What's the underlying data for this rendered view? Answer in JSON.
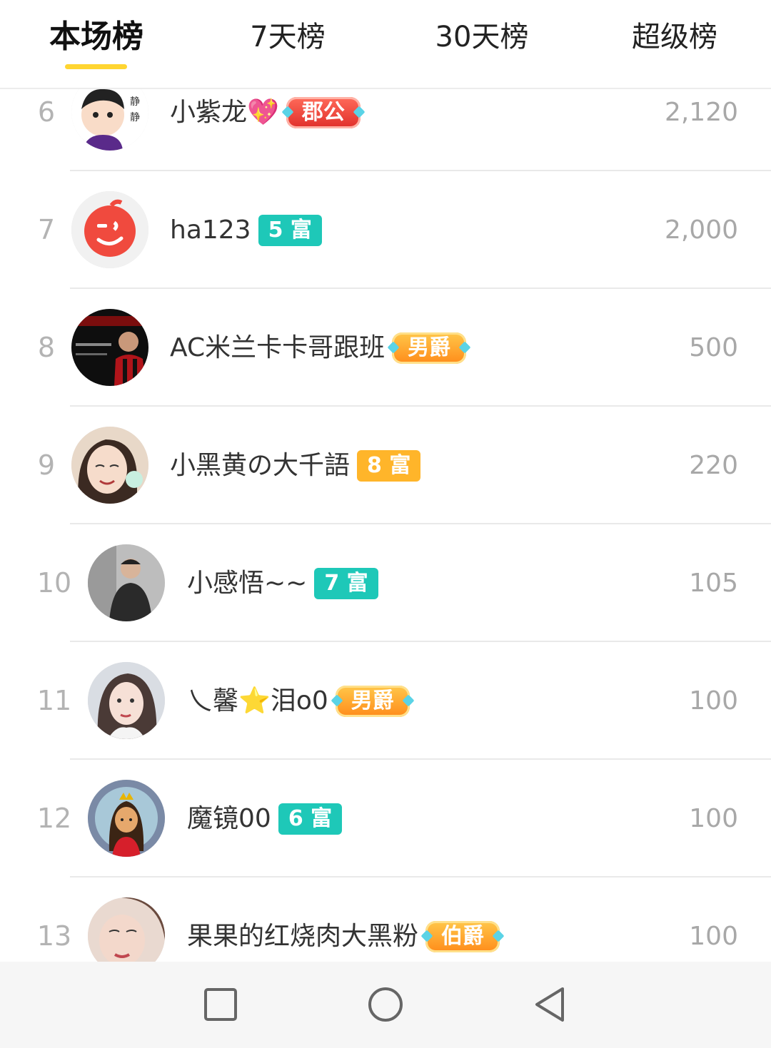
{
  "tabs": [
    {
      "label": "本场榜",
      "active": true
    },
    {
      "label": "7天榜",
      "active": false
    },
    {
      "label": "30天榜",
      "active": false
    },
    {
      "label": "超级榜",
      "active": false
    }
  ],
  "accent_color": "#ffd531",
  "rows": [
    {
      "rank": "6",
      "name": "小紫龙💖",
      "badge": "郡公",
      "badge_style": "noble-red",
      "score": "2,120"
    },
    {
      "rank": "7",
      "name": "ha123",
      "badge": "5 富",
      "badge_style": "teal",
      "score": "2,000"
    },
    {
      "rank": "8",
      "name": "AC米兰卡卡哥跟班",
      "badge": "男爵",
      "badge_style": "noble",
      "score": "500"
    },
    {
      "rank": "9",
      "name": "小黑黄の大千語",
      "badge": "8 富",
      "badge_style": "orange",
      "score": "220"
    },
    {
      "rank": "10",
      "name": "小感悟~~",
      "badge": "7 富",
      "badge_style": "teal",
      "score": "105"
    },
    {
      "rank": "11",
      "name": "乀馨⭐泪o0",
      "badge": "男爵",
      "badge_style": "noble",
      "score": "100"
    },
    {
      "rank": "12",
      "name": "魔镜00",
      "badge": "6 富",
      "badge_style": "teal",
      "score": "100"
    },
    {
      "rank": "13",
      "name": "果果的红烧肉大黑粉",
      "badge": "伯爵",
      "badge_style": "noble",
      "score": "100"
    }
  ],
  "navbar": {
    "icons": [
      "square-recents-icon",
      "circle-home-icon",
      "triangle-back-icon"
    ]
  }
}
